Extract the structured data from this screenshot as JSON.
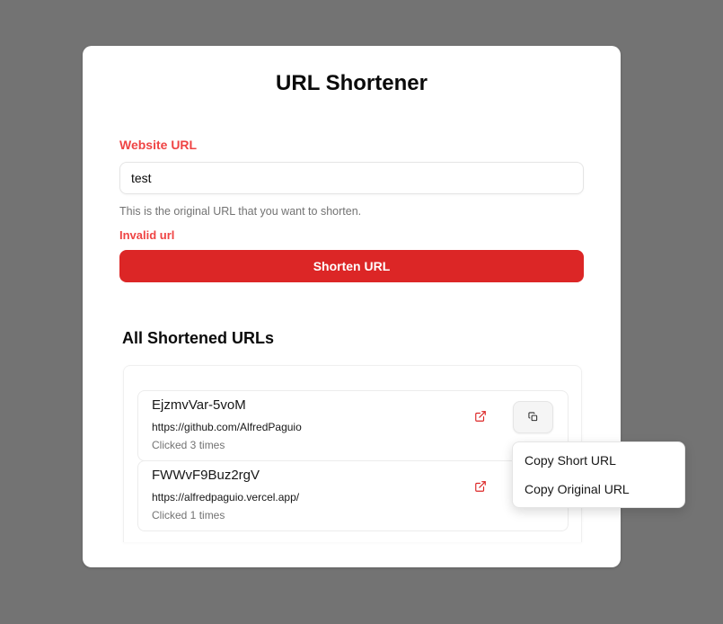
{
  "app": {
    "title": "URL Shortener"
  },
  "form": {
    "label": "Website URL",
    "input_value": "test",
    "helper_text": "This is the original URL that you want to shorten.",
    "error_text": "Invalid url",
    "submit_label": "Shorten URL"
  },
  "list": {
    "heading": "All Shortened URLs",
    "items": [
      {
        "code": "EjzmvVar-5voM",
        "url": "https://github.com/AlfredPaguio",
        "clicks": "Clicked 3 times"
      },
      {
        "code": "FWWvF9Buz2rgV",
        "url": "https://alfredpaguio.vercel.app/",
        "clicks": "Clicked 1 times"
      }
    ]
  },
  "context_menu": {
    "items": [
      {
        "label": "Copy Short URL"
      },
      {
        "label": "Copy Original URL"
      }
    ]
  },
  "colors": {
    "accent": "#dc2626",
    "label_red": "#ef4444",
    "backdrop": "#737373"
  },
  "icons": {
    "external_link": "external-link-icon",
    "copy": "copy-icon"
  }
}
